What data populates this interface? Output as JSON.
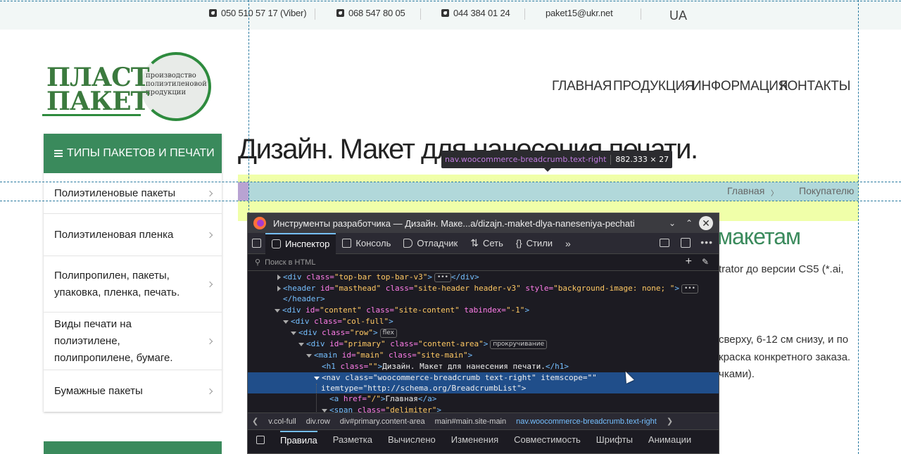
{
  "topbar": {
    "phone1": "050 510 57 17 (Viber)",
    "phone2": "068 547 80 05",
    "phone3": "044 384 01 24",
    "email": "paket15@ukr.net",
    "lang": "UA"
  },
  "logo": {
    "line1": "ПЛАСТ",
    "line2": "ПАКЕТ",
    "subtitle": "производство полиэтиленовой продукции"
  },
  "nav": {
    "items": [
      "ГЛАВНАЯ",
      "ПРОДУКЦИЯ",
      "ИНФОРМАЦИЯ",
      "КОНТАКТЫ"
    ]
  },
  "sidebar": {
    "title": "ТИПЫ ПАКЕТОВ И ПЕЧАТИ",
    "items": [
      {
        "label": "Полиэтиленовые пакеты"
      },
      {
        "label": "Полиэтиленовая пленка"
      },
      {
        "label": "Полипропилен, пакеты, упаковка, пленка, печать."
      },
      {
        "label": "Виды печати на полиэтилене, полипропилене, бумаге."
      },
      {
        "label": "Бумажные пакеты"
      }
    ]
  },
  "page": {
    "title": "Дизайн. Макет для нанесения печати.",
    "breadcrumb_home": "Главная",
    "breadcrumb_sep": "〉",
    "breadcrumb_next": "Покупателю",
    "heading_fragment": "макетам",
    "text1": "trator до версии CS5 (*.ai,",
    "text2": "сверху, 6-12 см снизу, и по",
    "text3": "краска конкретного заказа.",
    "text4": "чками)."
  },
  "tooltip": {
    "selector": "nav.woocommerce-breadcrumb.text-right",
    "size": "882.333 × 27"
  },
  "devtools": {
    "window_title": "Инструменты разработчика — Дизайн. Маке...a/dizajn.-maket-dlya-naneseniya-pechati",
    "tabs": [
      "Инспектор",
      "Консоль",
      "Отладчик",
      "Сеть",
      "Стили"
    ],
    "search_placeholder": "Поиск в HTML",
    "code": {
      "l1": [
        "<div ",
        "class=",
        "\"top-bar top-bar-v3\"",
        ">",
        "</div>"
      ],
      "l2": [
        "<header ",
        "id=",
        "\"masthead\" ",
        "class=",
        "\"site-header header-v3\" ",
        "style=",
        "\"background-image: none; \"",
        ">"
      ],
      "l2b": "</header>",
      "l3": [
        "<div ",
        "id=",
        "\"content\" ",
        "class=",
        "\"site-content\" ",
        "tabindex=",
        "\"-1\"",
        ">"
      ],
      "l4": [
        "<div ",
        "class=",
        "\"col-full\"",
        ">"
      ],
      "l5": [
        "<div ",
        "class=",
        "\"row\"",
        ">"
      ],
      "l5badge": "flex",
      "l6": [
        "<div ",
        "id=",
        "\"primary\" ",
        "class=",
        "\"content-area\"",
        ">"
      ],
      "l6badge": "прокручивание",
      "l7": [
        "<main ",
        "id=",
        "\"main\" ",
        "class=",
        "\"site-main\"",
        ">"
      ],
      "l8a": "<h1 ",
      "l8b": "class=",
      "l8c": "\"\"",
      "l8d": ">",
      "l8e": "Дизайн. Макет для нанесения печати.",
      "l8f": "</h1>",
      "l9": [
        "<nav ",
        "class=",
        "\"woocommerce-breadcrumb text-right\" ",
        "itemscope=",
        "\"\""
      ],
      "l9b": [
        "itemtype=",
        "\"http://schema.org/BreadcrumbList\"",
        ">"
      ],
      "l10a": "<a ",
      "l10b": "href=",
      "l10c": "\"/\"",
      "l10d": ">",
      "l10e": "Главная",
      "l10f": "</a>",
      "l11": [
        "<span ",
        "class=",
        "\"delimiter\"",
        ">"
      ]
    },
    "crumbs": [
      "v.col-full",
      "div.row",
      "div#primary.content-area",
      "main#main.site-main",
      "nav.woocommerce-breadcrumb.text-right"
    ],
    "bottom_tabs": [
      "Правила",
      "Разметка",
      "Вычислено",
      "Изменения",
      "Совместимость",
      "Шрифты",
      "Анимации"
    ]
  }
}
